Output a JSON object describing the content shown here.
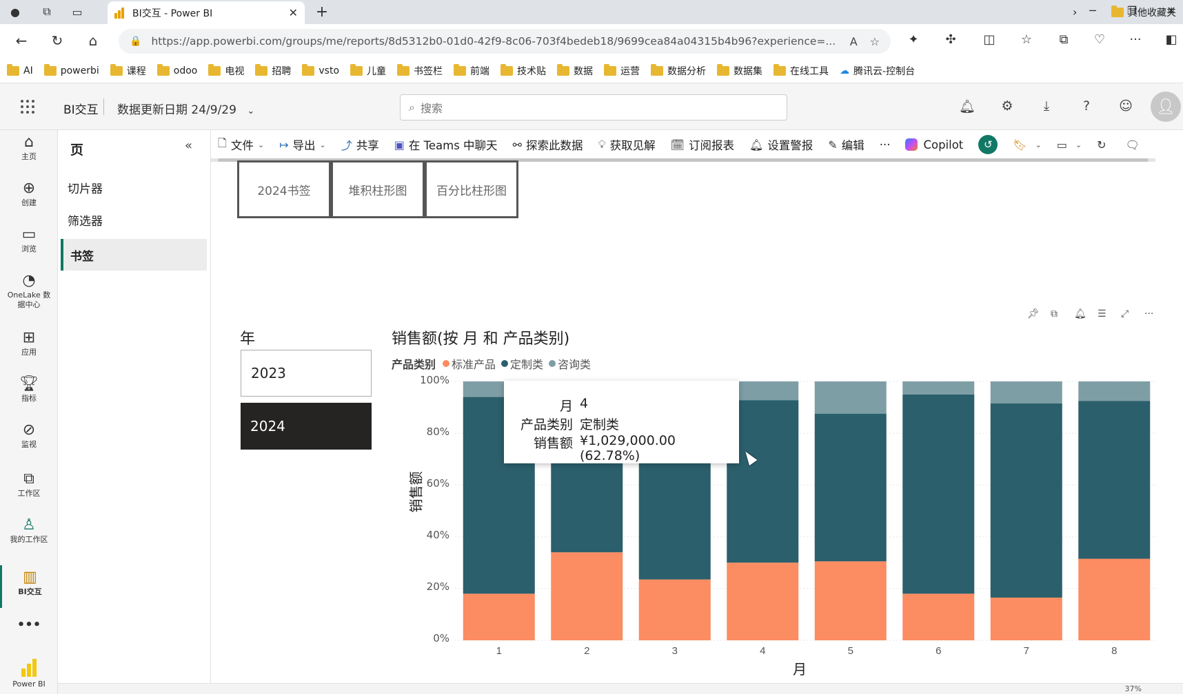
{
  "browser": {
    "tab_title": "BI交互 - Power BI",
    "url": "https://app.powerbi.com/groups/me/reports/8d5312b0-01d0-42f9-8c06-703f4bedeb18/9699cea84a04315b4b96?experience=...",
    "bookmarks": [
      "AI",
      "powerbi",
      "课程",
      "odoo",
      "电视",
      "招聘",
      "vsto",
      "儿童",
      "书签栏",
      "前端",
      "技术贴",
      "数据",
      "运营",
      "数据分析",
      "数据集",
      "在线工具",
      "腾讯云-控制台"
    ],
    "other_bookmarks": "其他收藏夹"
  },
  "header": {
    "app_name": "BI交互",
    "date_info": "数据更新日期 24/9/29",
    "search_placeholder": "搜索"
  },
  "leftnav": {
    "items": [
      "主页",
      "创建",
      "浏览",
      "OneLake 数据中心",
      "应用",
      "指标",
      "监视",
      "工作区",
      "我的工作区",
      "BI交互"
    ],
    "more": "•••",
    "brand": "Power BI"
  },
  "pages": {
    "title": "页",
    "items": [
      "切片器",
      "筛选器",
      "书签"
    ],
    "active_index": 2
  },
  "toolbar": {
    "file": "文件",
    "export": "导出",
    "share": "共享",
    "teams": "在 Teams 中聊天",
    "explore": "探索此数据",
    "insights": "获取见解",
    "subscribe": "订阅报表",
    "alert": "设置警报",
    "edit": "编辑",
    "more": "···",
    "copilot": "Copilot"
  },
  "bookmark_buttons": [
    "2024书签",
    "堆积柱形图",
    "百分比柱形图"
  ],
  "slicer": {
    "title": "年",
    "items": [
      {
        "label": "2023",
        "selected": false
      },
      {
        "label": "2024",
        "selected": true
      }
    ]
  },
  "chart_data": {
    "type": "bar",
    "stacking": "percent",
    "title": "销售额(按 月 和 产品类别)",
    "legend_title": "产品类别",
    "xlabel": "月",
    "ylabel": "销售额",
    "categories": [
      "1",
      "2",
      "3",
      "4",
      "5",
      "6",
      "7",
      "8"
    ],
    "yticks": [
      "100%",
      "80%",
      "60%",
      "40%",
      "20%",
      "0%"
    ],
    "ylim": [
      0,
      100
    ],
    "series": [
      {
        "name": "标准产品",
        "color": "#fc8c61",
        "values": [
          18,
          34,
          23.5,
          30,
          30.5,
          18,
          16.5,
          31.5
        ]
      },
      {
        "name": "定制类",
        "color": "#2b5f6c",
        "values": [
          76,
          58.5,
          69,
          62.78,
          57,
          77,
          75,
          61
        ]
      },
      {
        "name": "咨询类",
        "color": "#7e9ea6",
        "values": [
          6,
          7.5,
          7.5,
          7.22,
          12.5,
          5,
          8.5,
          7.5
        ]
      }
    ]
  },
  "tooltip": {
    "month_label": "月",
    "month_value": "4",
    "category_label": "产品类别",
    "category_value": "定制类",
    "sales_label": "销售额",
    "sales_value": "¥1,029,000.00 (62.78%)"
  },
  "status": {
    "zoom": "37%"
  }
}
